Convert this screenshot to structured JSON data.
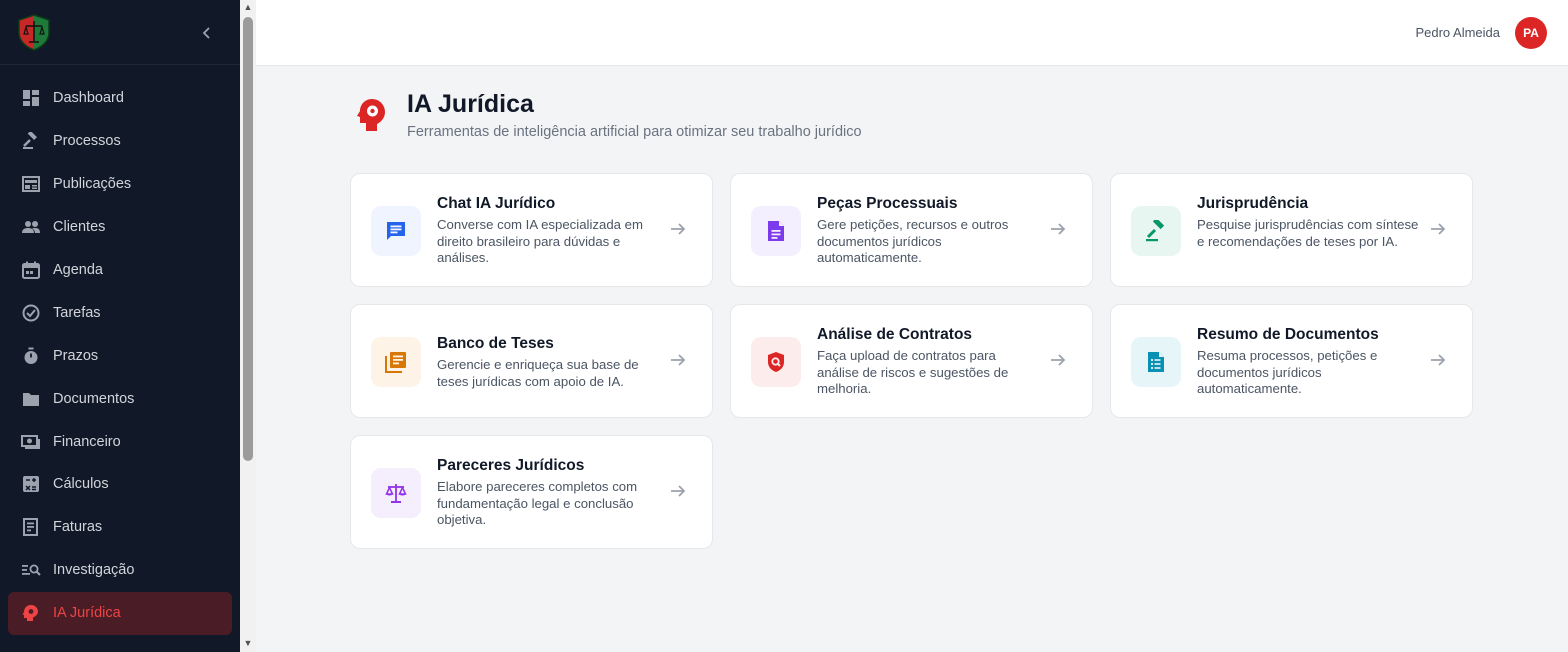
{
  "sidebar": {
    "collapse_icon": "chevron-left-icon",
    "items": [
      {
        "label": "Dashboard",
        "icon": "dashboard-icon",
        "active": false
      },
      {
        "label": "Processos",
        "icon": "gavel-icon",
        "active": false
      },
      {
        "label": "Publicações",
        "icon": "newspaper-icon",
        "active": false
      },
      {
        "label": "Clientes",
        "icon": "people-icon",
        "active": false
      },
      {
        "label": "Agenda",
        "icon": "calendar-icon",
        "active": false
      },
      {
        "label": "Tarefas",
        "icon": "check-circle-icon",
        "active": false
      },
      {
        "label": "Prazos",
        "icon": "stopwatch-icon",
        "active": false
      },
      {
        "label": "Documentos",
        "icon": "folder-icon",
        "active": false
      },
      {
        "label": "Financeiro",
        "icon": "money-icon",
        "active": false
      },
      {
        "label": "Cálculos",
        "icon": "calculator-icon",
        "active": false
      },
      {
        "label": "Faturas",
        "icon": "receipt-icon",
        "active": false
      },
      {
        "label": "Investigação",
        "icon": "manage-search-icon",
        "active": false
      },
      {
        "label": "IA Jurídica",
        "icon": "psychology-icon",
        "active": true
      }
    ]
  },
  "header": {
    "user_name": "Pedro Almeida",
    "avatar_initials": "PA"
  },
  "page": {
    "title": "IA Jurídica",
    "subtitle": "Ferramentas de inteligência artificial para otimizar seu trabalho jurídico",
    "icon": "psychology-icon"
  },
  "cards": [
    {
      "title": "Chat IA Jurídico",
      "description": "Converse com IA especializada em direito brasileiro para dúvidas e análises.",
      "icon": "chat-icon",
      "icon_color": "#2563eb",
      "icon_bg": "#eff4ff"
    },
    {
      "title": "Peças Processuais",
      "description": "Gere petições, recursos e outros documentos jurídicos automaticamente.",
      "icon": "document-icon",
      "icon_color": "#7c3aed",
      "icon_bg": "#f3effe"
    },
    {
      "title": "Jurisprudência",
      "description": "Pesquise jurisprudências com síntese e recomendações de teses por IA.",
      "icon": "gavel-icon",
      "icon_color": "#059669",
      "icon_bg": "#e7f6f0"
    },
    {
      "title": "Banco de Teses",
      "description": "Gerencie e enriqueça sua base de teses jurídicas com apoio de IA.",
      "icon": "library-books-icon",
      "icon_color": "#d97706",
      "icon_bg": "#fdf3e7"
    },
    {
      "title": "Análise de Contratos",
      "description": "Faça upload de contratos para análise de riscos e sugestões de melhoria.",
      "icon": "shield-search-icon",
      "icon_color": "#dc2626",
      "icon_bg": "#fdecec"
    },
    {
      "title": "Resumo de Documentos",
      "description": "Resuma processos, petições e documentos jurídicos automaticamente.",
      "icon": "summarize-icon",
      "icon_color": "#0891b2",
      "icon_bg": "#e6f5f8"
    },
    {
      "title": "Pareceres Jurídicos",
      "description": "Elabore pareceres completos com fundamentação legal e conclusão objetiva.",
      "icon": "scale-icon",
      "icon_color": "#9333ea",
      "icon_bg": "#f5eefd"
    }
  ]
}
